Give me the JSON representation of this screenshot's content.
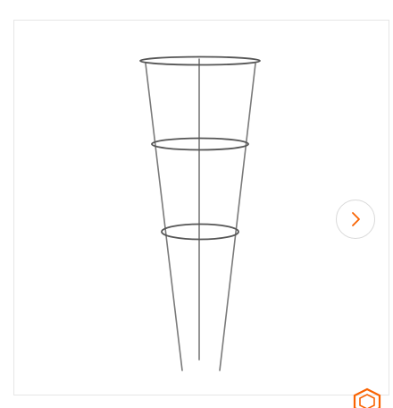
{
  "product_viewer": {
    "image": {
      "subject": "tomato-cage"
    },
    "next_button": {
      "icon": "chevron-right-icon",
      "accent_color": "#f96302"
    }
  },
  "brand": {
    "logo_color": "#f96302"
  }
}
